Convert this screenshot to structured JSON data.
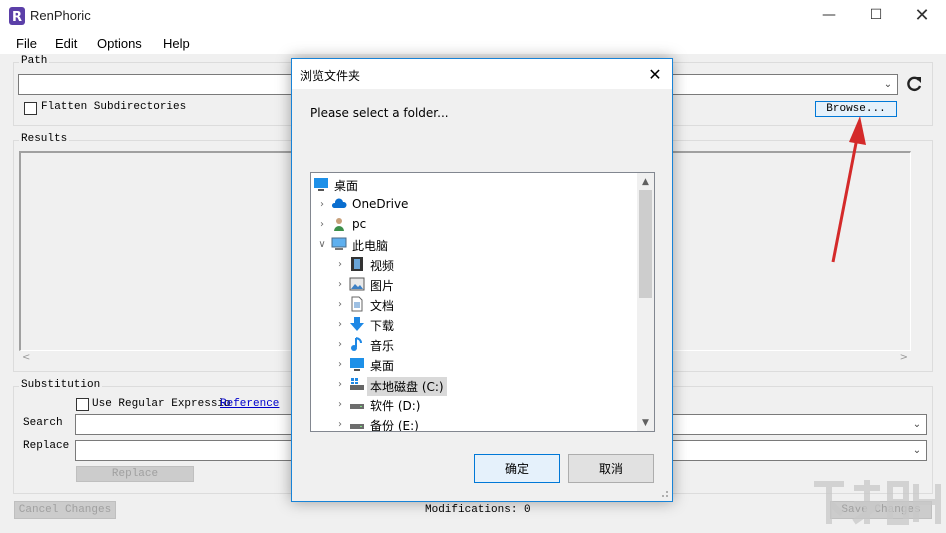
{
  "window": {
    "title": "RenPhoric"
  },
  "menu": [
    "File",
    "Edit",
    "Options",
    "Help"
  ],
  "path_group": {
    "label": "Path",
    "value": "",
    "flatten_label": "Flatten Subdirectories",
    "browse_label": "Browse..."
  },
  "results_group": {
    "label": "Results"
  },
  "substitution": {
    "label": "Substitution",
    "use_regex_label": "Use Regular Expressio",
    "reference_link": "Reference",
    "search_label": "Search",
    "replace_label": "Replace",
    "replace_button": "Replace"
  },
  "footer": {
    "cancel_changes": "Cancel Changes",
    "modifications": "Modifications: 0",
    "save_changes": "Save Changes"
  },
  "dialog": {
    "title": "浏览文件夹",
    "prompt": "Please select a folder...",
    "tree": [
      {
        "label": "桌面",
        "icon": "desktop-icon",
        "level": 0,
        "expander": "none"
      },
      {
        "label": "OneDrive",
        "icon": "cloud-icon",
        "level": 1,
        "expander": "collapsed"
      },
      {
        "label": "pc",
        "icon": "user-icon",
        "level": 1,
        "expander": "collapsed"
      },
      {
        "label": "此电脑",
        "icon": "computer-icon",
        "level": 1,
        "expander": "expanded"
      },
      {
        "label": "视频",
        "icon": "video-icon",
        "level": 2,
        "expander": "collapsed"
      },
      {
        "label": "图片",
        "icon": "pictures-icon",
        "level": 2,
        "expander": "collapsed"
      },
      {
        "label": "文档",
        "icon": "documents-icon",
        "level": 2,
        "expander": "collapsed"
      },
      {
        "label": "下载",
        "icon": "download-icon",
        "level": 2,
        "expander": "collapsed"
      },
      {
        "label": "音乐",
        "icon": "music-icon",
        "level": 2,
        "expander": "collapsed"
      },
      {
        "label": "桌面",
        "icon": "desktop-icon",
        "level": 2,
        "expander": "collapsed"
      },
      {
        "label": "本地磁盘 (C:)",
        "icon": "system-drive-icon",
        "level": 2,
        "expander": "collapsed",
        "selected": true
      },
      {
        "label": "软件 (D:)",
        "icon": "drive-icon",
        "level": 2,
        "expander": "collapsed"
      },
      {
        "label": "备份 (E:)",
        "icon": "drive-icon",
        "level": 2,
        "expander": "collapsed"
      }
    ],
    "ok_label": "确定",
    "cancel_label": "取消"
  },
  "colors": {
    "accent": "#0078d7",
    "annotation_arrow": "#d42a2a",
    "link": "#0000cc"
  }
}
